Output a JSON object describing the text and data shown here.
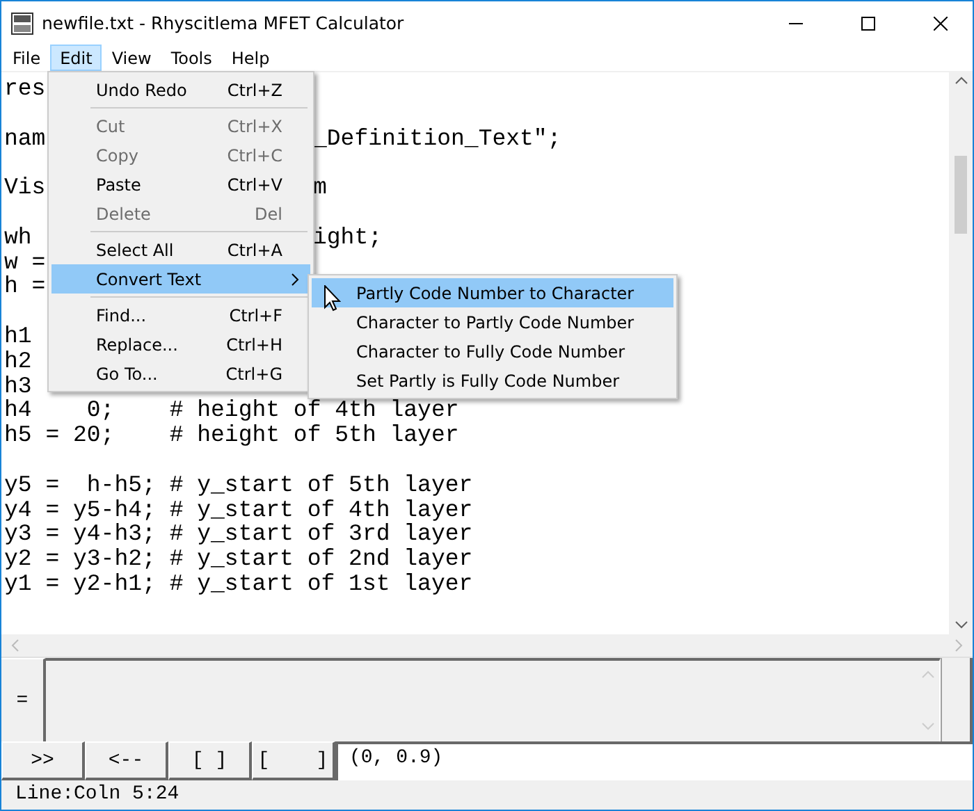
{
  "window": {
    "title": "newfile.txt - Rhyscitlema MFET Calculator"
  },
  "menu_bar": [
    {
      "label": "File",
      "selected": false
    },
    {
      "label": "Edit",
      "selected": true
    },
    {
      "label": "View",
      "selected": false
    },
    {
      "label": "Tools",
      "selected": false
    },
    {
      "label": "Help",
      "selected": false
    }
  ],
  "edit_menu": [
    {
      "kind": "item",
      "label": "Undo Redo",
      "shortcut": "Ctrl+Z",
      "disabled": false,
      "selected": false,
      "has_submenu": false
    },
    {
      "kind": "separator"
    },
    {
      "kind": "item",
      "label": "Cut",
      "shortcut": "Ctrl+X",
      "disabled": true,
      "selected": false,
      "has_submenu": false
    },
    {
      "kind": "item",
      "label": "Copy",
      "shortcut": "Ctrl+C",
      "disabled": true,
      "selected": false,
      "has_submenu": false
    },
    {
      "kind": "item",
      "label": "Paste",
      "shortcut": "Ctrl+V",
      "disabled": false,
      "selected": false,
      "has_submenu": false
    },
    {
      "kind": "item",
      "label": "Delete",
      "shortcut": "Del",
      "disabled": true,
      "selected": false,
      "has_submenu": false
    },
    {
      "kind": "separator"
    },
    {
      "kind": "item",
      "label": "Select All",
      "shortcut": "Ctrl+A",
      "disabled": false,
      "selected": false,
      "has_submenu": false
    },
    {
      "kind": "item",
      "label": "Convert Text",
      "disabled": false,
      "selected": true,
      "has_submenu": true
    },
    {
      "kind": "separator"
    },
    {
      "kind": "item",
      "label": "Find...",
      "shortcut": "Ctrl+F",
      "disabled": false,
      "selected": false,
      "has_submenu": false
    },
    {
      "kind": "item",
      "label": "Replace...",
      "shortcut": "Ctrl+H",
      "disabled": false,
      "selected": false,
      "has_submenu": false
    },
    {
      "kind": "item",
      "label": "Go To...",
      "shortcut": "Ctrl+G",
      "disabled": false,
      "selected": false,
      "has_submenu": false
    }
  ],
  "convert_submenu": [
    {
      "label": "Partly Code Number to Character",
      "selected": true
    },
    {
      "label": "Character to Partly Code Number",
      "selected": false
    },
    {
      "label": "Character to Fully Code Number",
      "selected": false
    },
    {
      "label": "Set Partly is Fully Code Number",
      "selected": false
    }
  ],
  "editor": {
    "lines": [
      {
        "kind": "code",
        "text": "res"
      },
      {
        "kind": "blank"
      },
      {
        "kind": "code",
        "text": "nam",
        "tail": "_Definition_Text\";"
      },
      {
        "kind": "blank"
      },
      {
        "kind": "code",
        "text": "Vis",
        "tail": "m"
      },
      {
        "kind": "blank"
      },
      {
        "kind": "code",
        "text": "wh",
        "tail": "ight;"
      },
      {
        "kind": "code",
        "text": "w ="
      },
      {
        "kind": "code",
        "text": "h ="
      },
      {
        "kind": "blank"
      },
      {
        "kind": "code",
        "text": "h1"
      },
      {
        "kind": "code",
        "text": "h2"
      },
      {
        "kind": "code",
        "text": "h3"
      },
      {
        "kind": "code",
        "text": "h4    0;    # height of 4th layer"
      },
      {
        "kind": "code",
        "text": "h5 = 20;    # height of 5th layer"
      },
      {
        "kind": "blank"
      },
      {
        "kind": "code",
        "text": "y5 =  h-h5; # y_start of 5th layer"
      },
      {
        "kind": "code",
        "text": "y4 = y5-h4; # y_start of 4th layer"
      },
      {
        "kind": "code",
        "text": "y3 = y4-h3; # y_start of 3rd layer"
      },
      {
        "kind": "code",
        "text": "y2 = y3-h2; # y_start of 2nd layer"
      },
      {
        "kind": "code",
        "text": "y1 = y2-h1; # y_start of 1st layer"
      }
    ]
  },
  "result_panel": {
    "label": "="
  },
  "buttons": [
    ">>",
    "<--",
    "[ ]",
    "[    ]"
  ],
  "coordinates_field": {
    "value": "(0, 0.9)"
  },
  "status_bar": {
    "text": "Line:Coln 5:24"
  }
}
